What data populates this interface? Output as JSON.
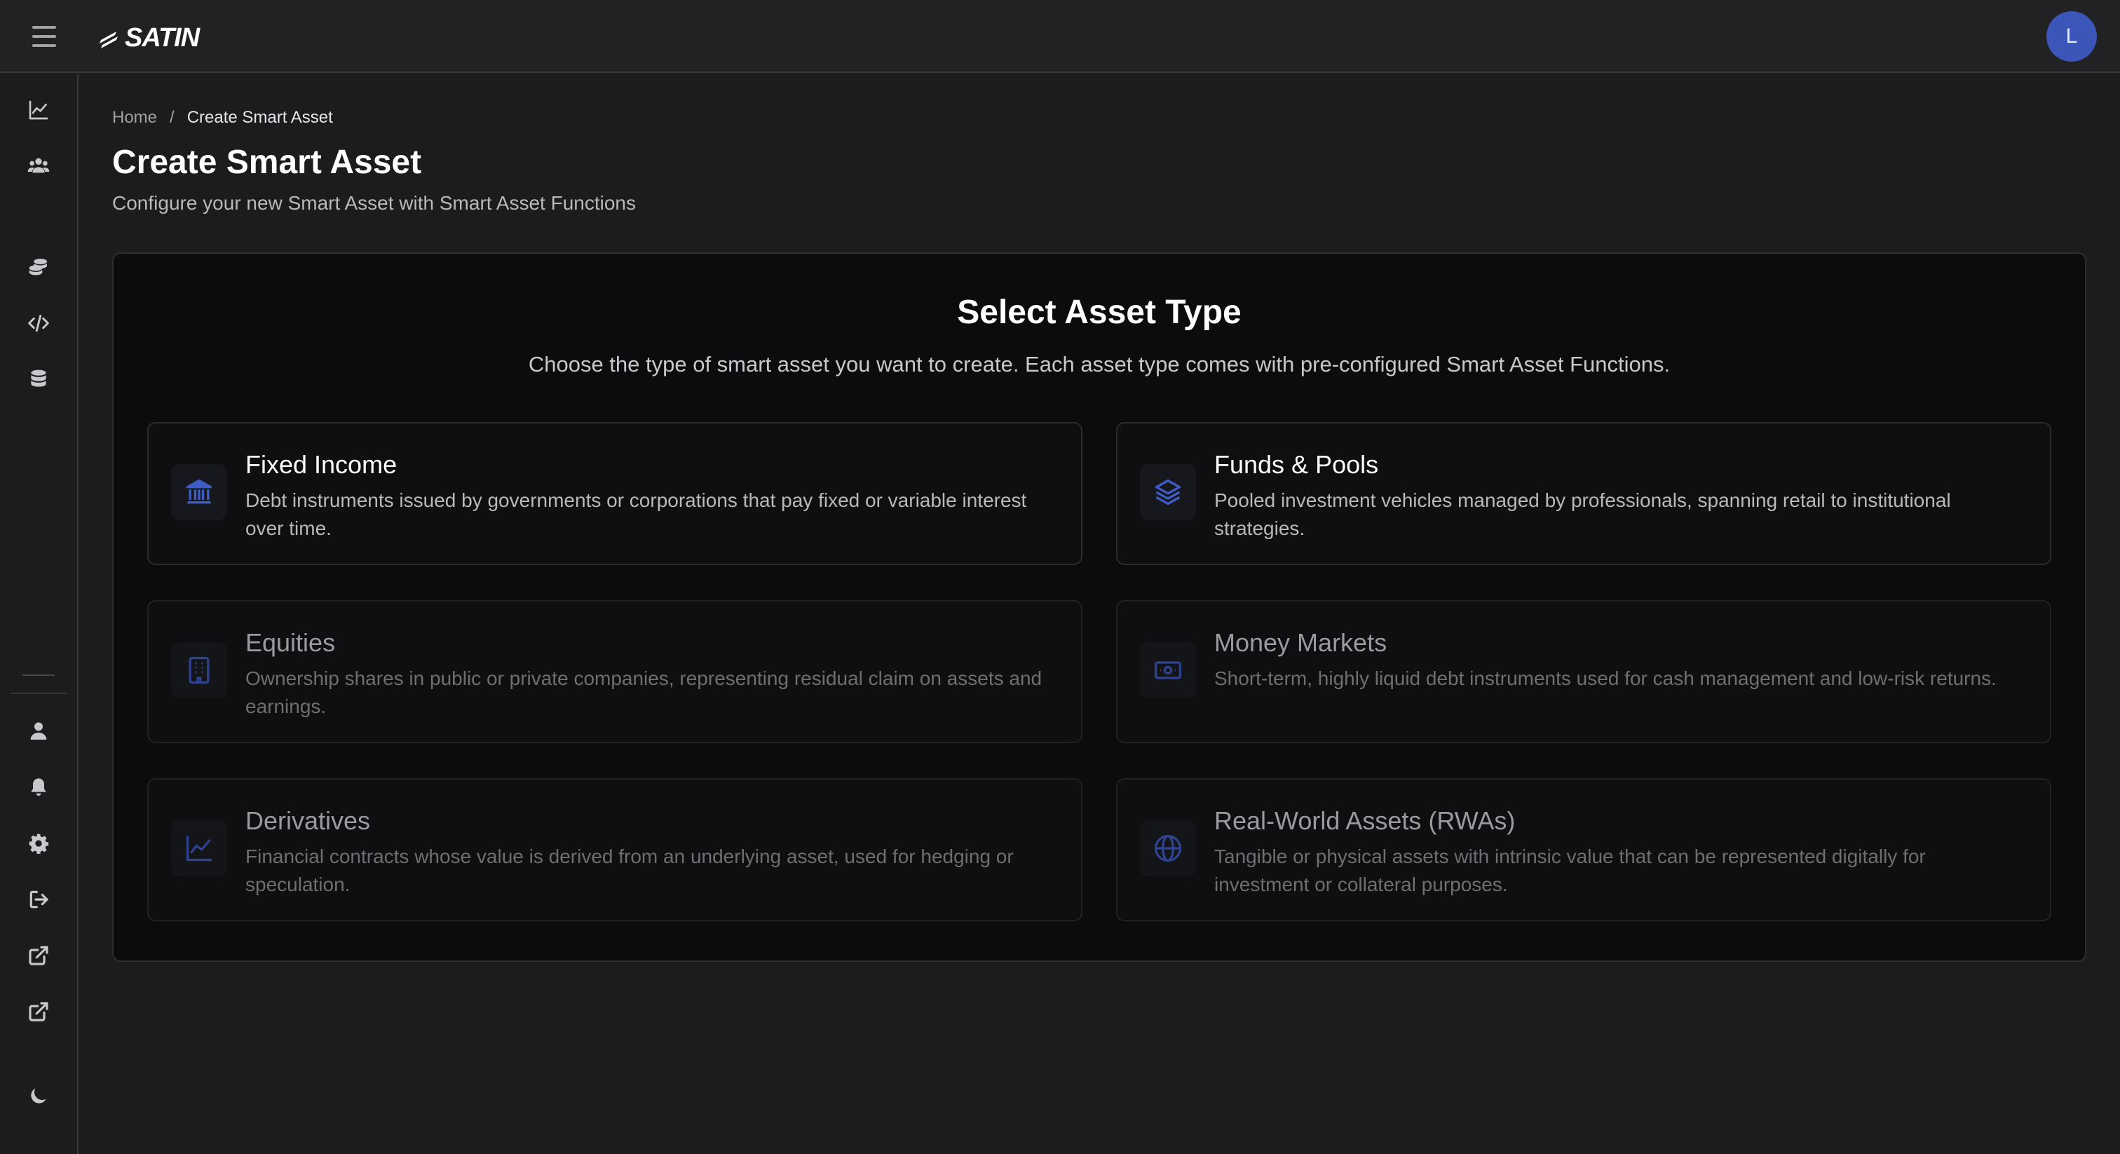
{
  "header": {
    "logo_text": "SATIN",
    "avatar_initial": "L"
  },
  "sidebar": {
    "items": [
      {
        "name": "analytics",
        "icon": "chart-line-icon"
      },
      {
        "name": "users",
        "icon": "users-icon"
      },
      {
        "name": "assets",
        "icon": "coins-icon"
      },
      {
        "name": "developer",
        "icon": "code-icon"
      },
      {
        "name": "database",
        "icon": "database-icon"
      },
      {
        "name": "profile",
        "icon": "user-icon"
      },
      {
        "name": "notifications",
        "icon": "bell-icon"
      },
      {
        "name": "settings",
        "icon": "gear-icon"
      },
      {
        "name": "logout",
        "icon": "logout-icon"
      },
      {
        "name": "external-link-1",
        "icon": "external-link-icon"
      },
      {
        "name": "external-link-2",
        "icon": "external-link-icon"
      },
      {
        "name": "theme-toggle",
        "icon": "moon-icon"
      }
    ]
  },
  "breadcrumb": {
    "home": "Home",
    "separator": "/",
    "current": "Create Smart Asset"
  },
  "page": {
    "title": "Create Smart Asset",
    "subtitle": "Configure your new Smart Asset with Smart Asset Functions"
  },
  "panel": {
    "title": "Select Asset Type",
    "description": "Choose the type of smart asset you want to create. Each asset type comes with pre-configured Smart Asset Functions."
  },
  "asset_types": [
    {
      "title": "Fixed Income",
      "description": "Debt instruments issued by governments or corporations that pay fixed or variable interest over time.",
      "icon": "bank-icon",
      "enabled": true
    },
    {
      "title": "Funds & Pools",
      "description": "Pooled investment vehicles managed by professionals, spanning retail to institutional strategies.",
      "icon": "layers-icon",
      "enabled": true
    },
    {
      "title": "Equities",
      "description": "Ownership shares in public or private companies, representing residual claim on assets and earnings.",
      "icon": "building-icon",
      "enabled": false
    },
    {
      "title": "Money Markets",
      "description": "Short-term, highly liquid debt instruments used for cash management and low-risk returns.",
      "icon": "banknote-icon",
      "enabled": false
    },
    {
      "title": "Derivatives",
      "description": "Financial contracts whose value is derived from an underlying asset, used for hedging or speculation.",
      "icon": "chart-line-icon",
      "enabled": false
    },
    {
      "title": "Real-World Assets (RWAs)",
      "description": "Tangible or physical assets with intrinsic value that can be represented digitally for investment or collateral purposes.",
      "icon": "globe-icon",
      "enabled": false
    }
  ],
  "colors": {
    "accent": "#3e5dc8",
    "avatar_bg": "#3b55b8",
    "background": "#1c1c1e",
    "panel_bg": "#0c0c0e"
  }
}
